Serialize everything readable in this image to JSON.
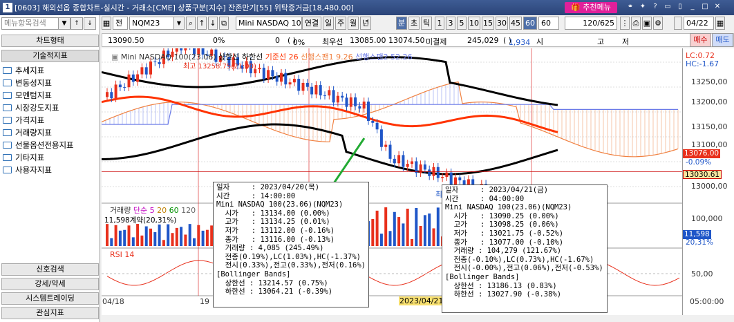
{
  "title_bar": {
    "num": "1",
    "title": "[0603] 해외선옵 종합차트-실시간 - 거래소[CME] 상품구분[지수] 잔존만기[55] 위탁증거금[18,480.00]",
    "rec_menu": "추천메뉴"
  },
  "left_panel": {
    "search_placeholder": "메뉴항목검색",
    "tabs_top": [
      "차트형태",
      "기술적지표"
    ],
    "tree": [
      "추세지표",
      "변동성지표",
      "모멘텀지표",
      "시장강도지표",
      "가격지표",
      "거래량지표",
      "선물옵션전용지표",
      "기타지표",
      "사용자지표"
    ],
    "tabs_bottom": [
      "신호검색",
      "강세/약세",
      "시스템트레이딩",
      "관심지표"
    ]
  },
  "toolbar": {
    "jeon": "전",
    "code": "NQM23",
    "product_name": "Mini NASDAQ 100(23.06)",
    "period_buttons": [
      "연결",
      "일",
      "주",
      "월",
      "년",
      "분",
      "초",
      "틱"
    ],
    "selected_period": "분",
    "interval_buttons": [
      "1",
      "3",
      "5",
      "10",
      "15",
      "30",
      "45",
      "60"
    ],
    "selected_interval": "60",
    "interval_value": "60",
    "count": "120/625",
    "date": "04/22"
  },
  "info_bar": {
    "price": "13090.50",
    "pct": "0%",
    "zero": "0",
    "paren_pct": "0%",
    "best_ask_label": "최우선",
    "best_ask": "13085.00",
    "best_bid": "13074.50",
    "unsettled_label": "미결제",
    "unsettled": "245,029",
    "unsettled_change": "1,934",
    "si": "시",
    "go": "고",
    "jeo": "저",
    "buy": "매수",
    "sell": "매도"
  },
  "chart": {
    "legend_main": {
      "name": "Mini NASDAQ 100(23.06)",
      "upper": "상한선",
      "lower": "하한선",
      "base": "기준선 26",
      "span1": "선행스팬1 9.26",
      "span2": "선행스팬2 52.26"
    },
    "high_label": "최고 13258.75(21:00)",
    "low_label": "최",
    "lc": "LC:0.72",
    "hc": "HC:-1.67",
    "price_axis": [
      "13250,00",
      "13200,00",
      "13150,00",
      "13100,00",
      "13050,00",
      "13000,00"
    ],
    "current_price": "13076.00",
    "current_pct": "-0.09%",
    "low_line_price": "13030.61",
    "volume_legend": {
      "name": "거래량",
      "ma": "단순",
      "p1": "5",
      "p2": "20",
      "p3": "60",
      "p4": "120"
    },
    "volume_contract": "11,598계약(20,31%)",
    "volume_axis": "100,000",
    "volume_value": "11,598",
    "volume_pct": "20,31%",
    "rsi_legend": "RSI 14",
    "rsi_axis": "50,00",
    "x_labels": [
      "04/18",
      "19",
      "2023/04/21",
      "05:00:00"
    ],
    "tooltip1": {
      "lines": [
        "일자     : 2023/04/20(목)",
        "시간     : 14:00:00",
        "Mini NASDAQ 100(23.06)(NQM23)",
        "  시가   : 13134.00 (0.00%)",
        "  고가   : 13134.25 (0.01%)",
        "  저가   : 13112.00 (-0.16%)",
        "  종가   : 13116.00 (-0.13%)",
        "  거래량 : 4,085 (245.49%)",
        "  전종(0.19%),LC(1.03%),HC(-1.37%)",
        "  전시(0.33%),전고(0.33%),전저(0.16%)",
        "[Bollinger Bands]",
        "  상한선 : 13214.57 (0.75%)",
        "  하한선 : 13064.21 (-0.39%)"
      ]
    },
    "tooltip2": {
      "lines": [
        "일자     : 2023/04/21(금)",
        "시간     : 04:00:00",
        "Mini NASDAQ 100(23.06)(NQM23)",
        "  시가   : 13090.25 (0.00%)",
        "  고가   : 13098.25 (0.06%)",
        "  저가   : 13021.75 (-0.52%)",
        "  종가   : 13077.00 (-0.10%)",
        "  거래량 : 104,279 (121.67%)",
        "  전종(-0.10%),LC(0.73%),HC(-1.67%)",
        "  전시(-0.00%),전고(0.06%),전저(-0.53%)",
        "[Bollinger Bands]",
        "  상한선 : 13186.13 (0.83%)",
        "  하한선 : 13027.90 (-0.38%)"
      ]
    }
  },
  "colors": {
    "up": "#e8301c",
    "down": "#1f56c8",
    "upper_band": "#000000",
    "base_line": "#ff3300",
    "span1": "#f08040",
    "span2": "#6a7ae8"
  }
}
